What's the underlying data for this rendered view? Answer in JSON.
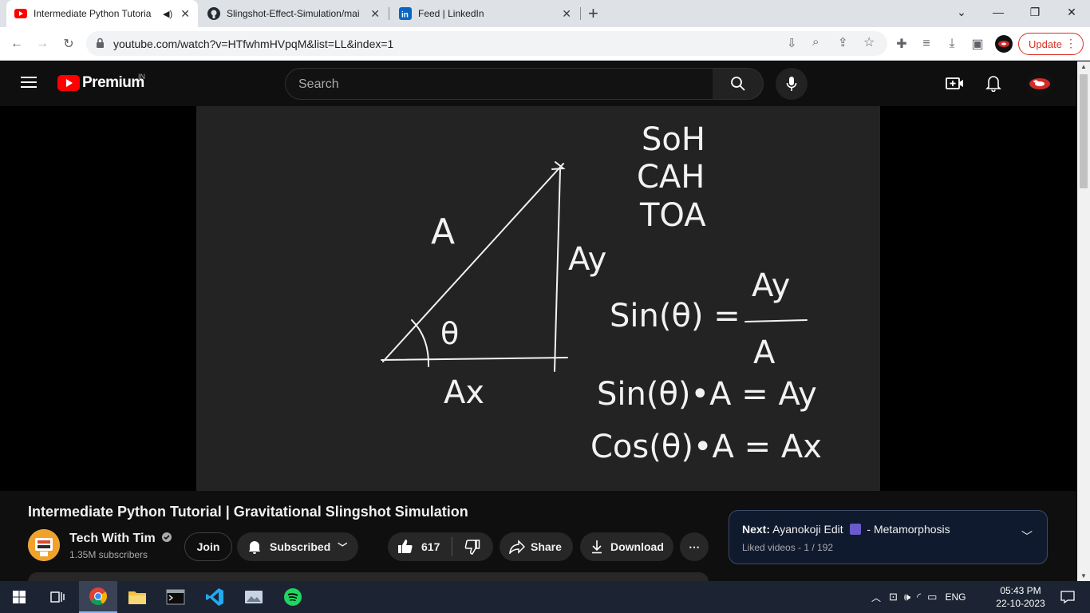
{
  "browser": {
    "tabs": [
      {
        "title": "Intermediate Python Tutoria",
        "active": true
      },
      {
        "title": "Slingshot-Effect-Simulation/mai",
        "active": false
      },
      {
        "title": "Feed | LinkedIn",
        "active": false
      }
    ],
    "new_tab_symbol": "+",
    "url": "youtube.com/watch?v=HTfwhmHVpqM&list=LL&index=1",
    "update_label": "Update"
  },
  "youtube": {
    "brand": "Premium",
    "region": "IN",
    "search_placeholder": "Search"
  },
  "video": {
    "board": {
      "mnemonic": [
        "SoH",
        "CAH",
        "TOA"
      ],
      "labels": {
        "hyp": "A",
        "opp": "Ay",
        "adj": "Ax",
        "angle": "θ",
        "eq1_left": "Sin(θ) =",
        "eq1_num": "Ay",
        "eq1_den": "A",
        "eq2": "Sin(θ)•A = Ay",
        "eq3": "Cos(θ)•A = Ax"
      }
    },
    "title": "Intermediate Python Tutorial | Gravitational Slingshot Simulation",
    "channel": "Tech With Tim",
    "subscribers": "1.35M subscribers",
    "join_label": "Join",
    "subscribed_label": "Subscribed",
    "likes": "617",
    "share_label": "Share",
    "download_label": "Download",
    "more_label": "⋯"
  },
  "next": {
    "prefix": "Next:",
    "title": "Ayanokoji Edit",
    "suffix": "- Metamorphosis",
    "playlist": "Liked videos - 1 / 192"
  },
  "taskbar": {
    "lang": "ENG",
    "time": "05:43 PM",
    "date": "22-10-2023"
  },
  "colors": {
    "yt_red": "#ff0000",
    "update_red": "#d93025",
    "video_bg": "#232323"
  }
}
